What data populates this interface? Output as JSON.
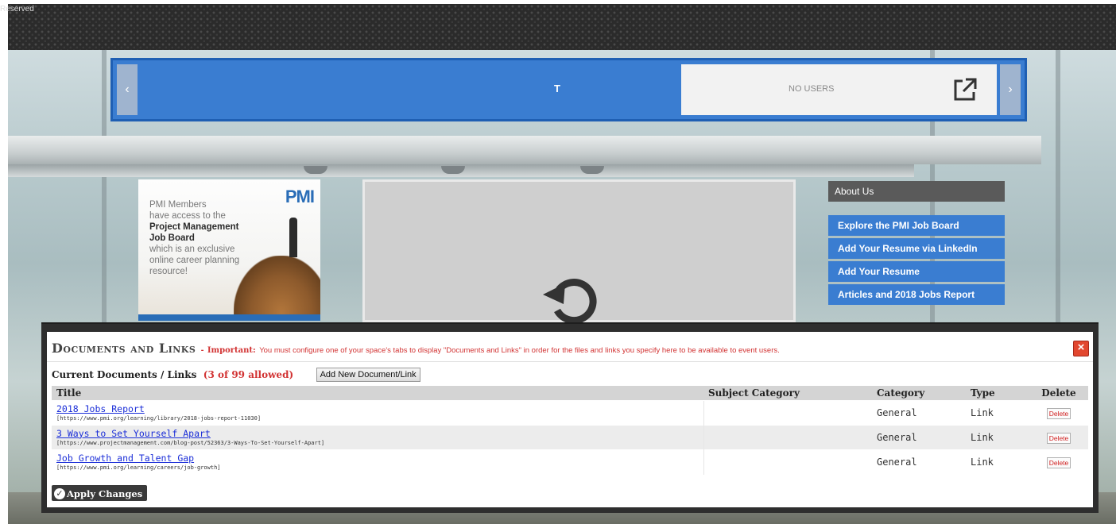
{
  "header": {
    "reserved_text": "Reserved"
  },
  "users_bar": {
    "user_initial": "T",
    "no_users_text": "NO USERS",
    "prev_icon": "chevron-left-icon",
    "next_icon": "chevron-right-icon",
    "popout_icon": "external-link-icon",
    "prev_arrow": "‹",
    "next_arrow": "›"
  },
  "pmi_ad": {
    "logo": "PMI",
    "line1": "PMI Members",
    "line2": "have access to the",
    "line3": "Project Management",
    "line4": "Job Board",
    "line5": "which is an exclusive",
    "line6": "online career planning",
    "line7": "resource!"
  },
  "video_panel": {
    "icon": "reload-icon"
  },
  "side_menu": {
    "about": "About Us",
    "items": [
      "Explore the PMI Job Board",
      "Add Your Resume via LinkedIn",
      "Add Your Resume",
      "Articles and 2018 Jobs Report"
    ]
  },
  "modal": {
    "title": "Documents and Links",
    "separator": "-",
    "important_label": "Important:",
    "important_text": "You must configure one of your space's tabs to display \"Documents and Links\" in order for the files and links you specify here to be available to event users.",
    "close_label": "×",
    "current_label": "Current Documents / Links",
    "current_count": "(3 of 99 allowed)",
    "add_button": "Add New Document/Link",
    "columns": {
      "title": "Title",
      "subject": "Subject Category",
      "category": "Category",
      "type": "Type",
      "delete": "Delete"
    },
    "rows": [
      {
        "title": "2018 Jobs Report",
        "url": "[https://www.pmi.org/learning/library/2018-jobs-report-11030]",
        "subject": "",
        "category": "General",
        "type": "Link",
        "delete": "Delete"
      },
      {
        "title": "3 Ways to Set Yourself Apart",
        "url": "[https://www.projectmanagement.com/blog-post/52363/3-Ways-To-Set-Yourself-Apart]",
        "subject": "",
        "category": "General",
        "type": "Link",
        "delete": "Delete"
      },
      {
        "title": "Job Growth and Talent Gap",
        "url": "[https://www.pmi.org/learning/careers/job-growth]",
        "subject": "",
        "category": "General",
        "type": "Link",
        "delete": "Delete"
      }
    ],
    "apply_button": "Apply Changes",
    "apply_icon": "check-circle-icon",
    "apply_check": "✓"
  },
  "colors": {
    "accent_blue": "#3a7dd1",
    "alert_red": "#d23333",
    "link_blue": "#1b2ed8",
    "modal_frame": "#2e2e2e"
  }
}
